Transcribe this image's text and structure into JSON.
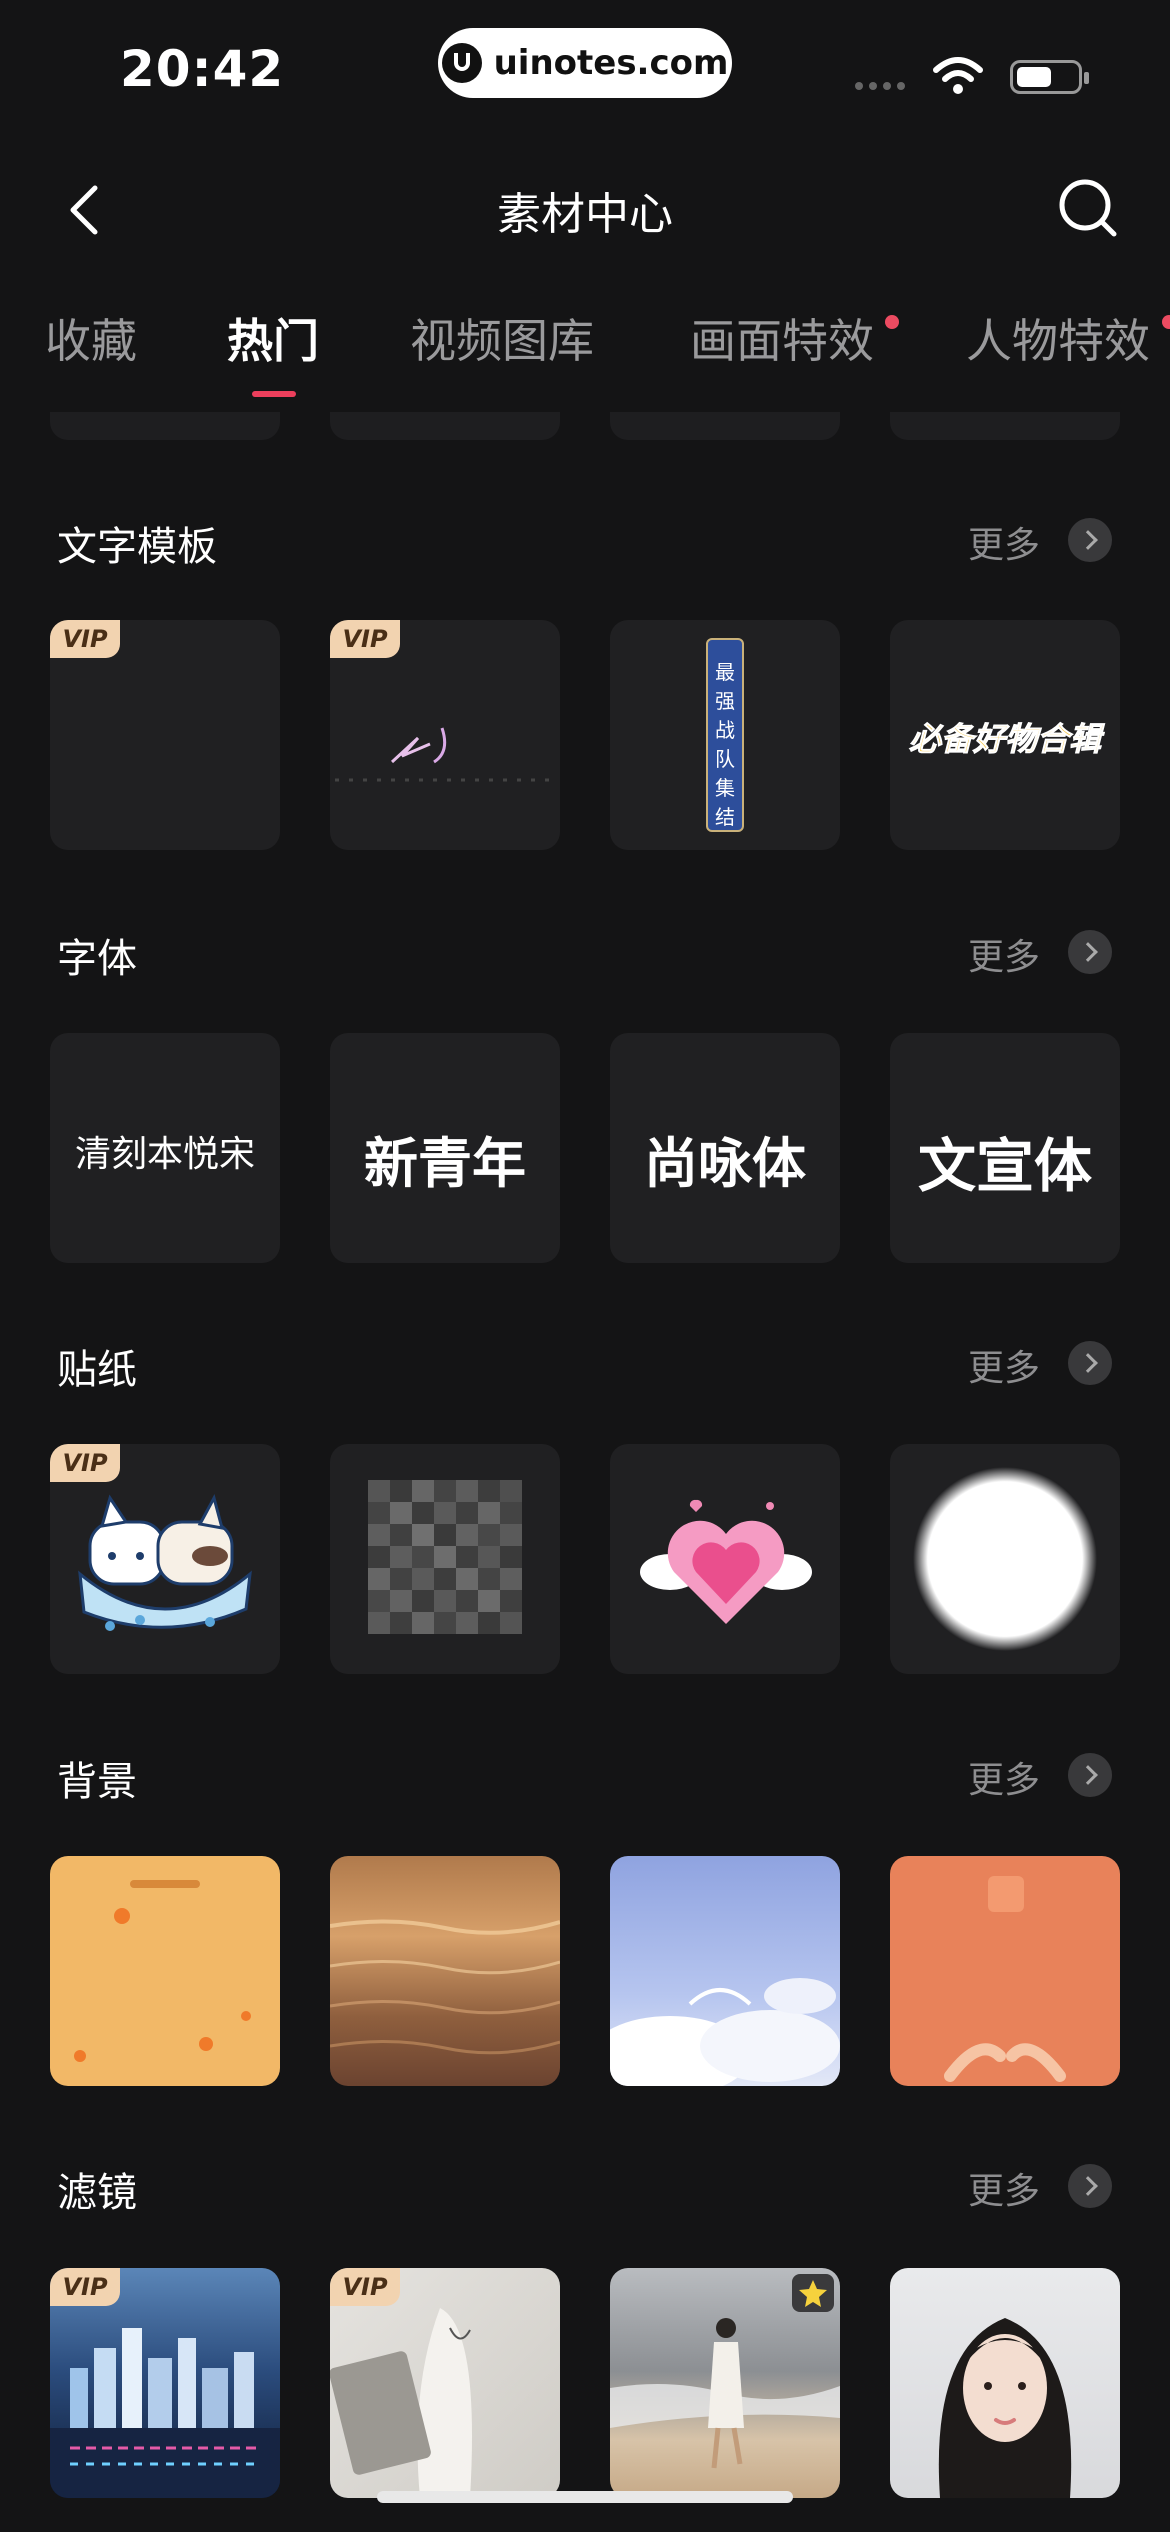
{
  "status_bar": {
    "time": "20:42",
    "url": "uinotes.com"
  },
  "header": {
    "title": "素材中心"
  },
  "tabs": [
    {
      "label": "收藏",
      "active": false,
      "dot": false
    },
    {
      "label": "热门",
      "active": true,
      "dot": false
    },
    {
      "label": "视频图库",
      "active": false,
      "dot": false
    },
    {
      "label": "画面特效",
      "active": false,
      "dot": true
    },
    {
      "label": "人物特效",
      "active": false,
      "dot": true
    }
  ],
  "more_label": "更多",
  "vip_label": "VIP",
  "sections": {
    "text_templates": {
      "title": "文字模板",
      "items": [
        {
          "vip": true,
          "text": ""
        },
        {
          "vip": true,
          "text": ""
        },
        {
          "vip": false,
          "text": "最强战队集结"
        },
        {
          "vip": false,
          "text": "必备好物合辑"
        }
      ]
    },
    "fonts": {
      "title": "字体",
      "items": [
        "清刻本悦宋",
        "新青年",
        "尚咏体",
        "文宣体"
      ]
    },
    "stickers": {
      "title": "贴纸"
    },
    "backgrounds": {
      "title": "背景"
    },
    "filters": {
      "title": "滤镜"
    }
  },
  "colors": {
    "accent": "#ec3f5c",
    "background": "#141415",
    "tile": "#202022",
    "vip_bg": "#f2d3b0"
  }
}
